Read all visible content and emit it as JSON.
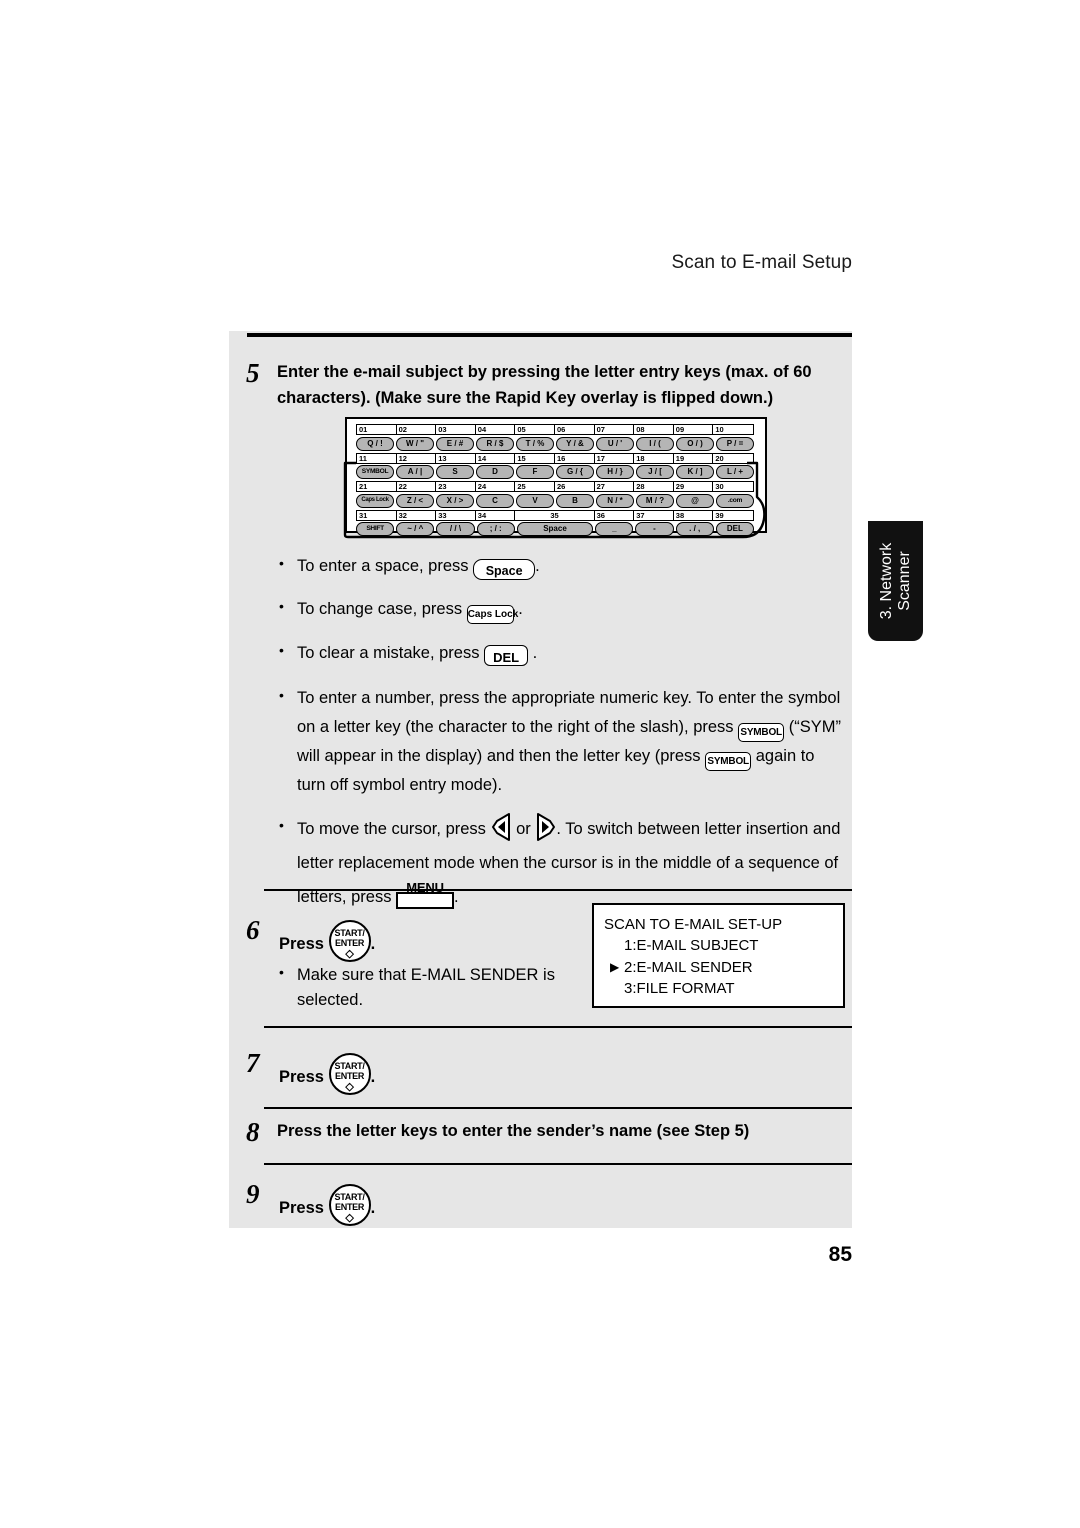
{
  "header": {
    "running_title": "Scan to E-mail Setup"
  },
  "side_tab": {
    "line1": "3. Network",
    "line2": "Scanner"
  },
  "page_number": "85",
  "steps": [
    {
      "number": "5",
      "text": "Enter the e-mail subject by pressing the letter entry keys (max. of 60 characters). (Make sure the Rapid Key overlay is flipped down.)"
    },
    {
      "number": "6",
      "press_label": "Press",
      "bullet": "Make sure that E-MAIL SENDER is selected."
    },
    {
      "number": "7",
      "press_label": "Press"
    },
    {
      "number": "8",
      "text": "Press the letter keys to enter the sender’s name (see Step 5)"
    },
    {
      "number": "9",
      "press_label": "Press"
    }
  ],
  "bullets": {
    "space": {
      "before": "To enter a space, press",
      "key": "Space",
      "after": "."
    },
    "case": {
      "before": "To change case, press",
      "key": "Caps Lock",
      "after": "."
    },
    "mistake": {
      "before": "To clear a mistake, press",
      "key": "DEL",
      "after": "."
    },
    "symbol": {
      "part1": "To enter a number, press the appropriate numeric key. To enter the symbol on a letter key (the character to the right of the slash), press",
      "key1": "SYMBOL",
      "part2": "(“SYM” will appear in the display) and then the letter key (press",
      "key2": "SYMBOL",
      "part3": "again to turn off symbol entry mode)."
    },
    "cursor": {
      "part1": "To move the cursor, press",
      "key_left": "left-arrow",
      "conjunction": "or",
      "key_right": "right-arrow",
      "part2": ". To switch between letter insertion and letter replacement mode when the cursor is in the middle of a sequence of letters, press",
      "key_menu": "MENU",
      "part3": "."
    }
  },
  "enter_key": {
    "line1": "START/",
    "line2": "ENTER",
    "glyph": "◇"
  },
  "lcd": {
    "title": "SCAN TO E-MAIL SET-UP",
    "items": [
      {
        "pointer": "",
        "label": "1:E-MAIL SUBJECT"
      },
      {
        "pointer": "▶",
        "label": "2:E-MAIL SENDER"
      },
      {
        "pointer": "",
        "label": "3:FILE FORMAT"
      }
    ]
  },
  "keyboard": {
    "rows": [
      {
        "numbers": [
          "01",
          "02",
          "03",
          "04",
          "05",
          "06",
          "07",
          "08",
          "09",
          "10"
        ],
        "keys": [
          "Q / !",
          "W / \"",
          "E / #",
          "R / $",
          "T / %",
          "Y / &",
          "U / '",
          "I / (",
          "O / )",
          "P / ="
        ]
      },
      {
        "numbers": [
          "11",
          "12",
          "13",
          "14",
          "15",
          "16",
          "17",
          "18",
          "19",
          "20"
        ],
        "keys": [
          "SYMBOL",
          "A / |",
          "S",
          "D",
          "F",
          "G / {",
          "H / }",
          "J / [",
          "K / ]",
          "L / +"
        ]
      },
      {
        "numbers": [
          "21",
          "22",
          "23",
          "24",
          "25",
          "26",
          "27",
          "28",
          "29",
          "30"
        ],
        "keys": [
          "Caps Lock",
          "Z / <",
          "X / >",
          "C",
          "V",
          "B",
          "N / *",
          "M / ?",
          "@",
          ".com"
        ]
      },
      {
        "numbers": [
          "31",
          "32",
          "33",
          "34",
          "35",
          "36",
          "37",
          "38",
          "39"
        ],
        "keys": [
          "SHIFT",
          "~ / ^",
          "/ / \\",
          "; / :",
          "Space",
          "_",
          "-",
          ". / ,",
          "DEL"
        ]
      }
    ]
  }
}
